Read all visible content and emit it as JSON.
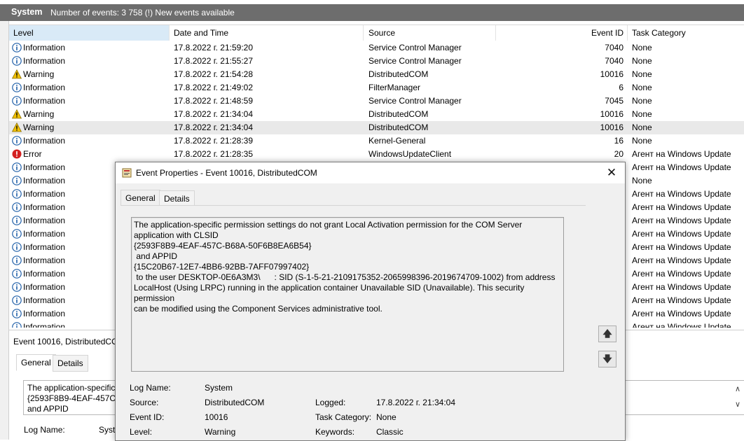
{
  "header": {
    "title": "System",
    "count_text": "Number of events: 3 758 (!) New events available"
  },
  "columns": {
    "level": "Level",
    "date": "Date and Time",
    "source": "Source",
    "event_id": "Event ID",
    "task": "Task Category"
  },
  "events": [
    {
      "level": "Information",
      "date": "17.8.2022 г. 21:59:20",
      "source": "Service Control Manager",
      "id": "7040",
      "task": "None"
    },
    {
      "level": "Information",
      "date": "17.8.2022 г. 21:55:27",
      "source": "Service Control Manager",
      "id": "7040",
      "task": "None"
    },
    {
      "level": "Warning",
      "date": "17.8.2022 г. 21:54:28",
      "source": "DistributedCOM",
      "id": "10016",
      "task": "None"
    },
    {
      "level": "Information",
      "date": "17.8.2022 г. 21:49:02",
      "source": "FilterManager",
      "id": "6",
      "task": "None"
    },
    {
      "level": "Information",
      "date": "17.8.2022 г. 21:48:59",
      "source": "Service Control Manager",
      "id": "7045",
      "task": "None"
    },
    {
      "level": "Warning",
      "date": "17.8.2022 г. 21:34:04",
      "source": "DistributedCOM",
      "id": "10016",
      "task": "None"
    },
    {
      "level": "Warning",
      "date": "17.8.2022 г. 21:34:04",
      "source": "DistributedCOM",
      "id": "10016",
      "task": "None"
    },
    {
      "level": "Information",
      "date": "17.8.2022 г. 21:28:39",
      "source": "Kernel-General",
      "id": "16",
      "task": "None"
    },
    {
      "level": "Error",
      "date": "17.8.2022 г. 21:28:35",
      "source": "WindowsUpdateClient",
      "id": "20",
      "task": "Агент на Windows Update"
    },
    {
      "level": "Information",
      "date": "",
      "source": "",
      "id": "",
      "task": "Агент на Windows Update"
    },
    {
      "level": "Information",
      "date": "",
      "source": "",
      "id": "",
      "task": "None"
    },
    {
      "level": "Information",
      "date": "",
      "source": "",
      "id": "",
      "task": "Агент на Windows Update"
    },
    {
      "level": "Information",
      "date": "",
      "source": "",
      "id": "",
      "task": "Агент на Windows Update"
    },
    {
      "level": "Information",
      "date": "",
      "source": "",
      "id": "",
      "task": "Агент на Windows Update"
    },
    {
      "level": "Information",
      "date": "",
      "source": "",
      "id": "",
      "task": "Агент на Windows Update"
    },
    {
      "level": "Information",
      "date": "",
      "source": "",
      "id": "",
      "task": "Агент на Windows Update"
    },
    {
      "level": "Information",
      "date": "",
      "source": "",
      "id": "",
      "task": "Агент на Windows Update"
    },
    {
      "level": "Information",
      "date": "",
      "source": "",
      "id": "",
      "task": "Агент на Windows Update"
    },
    {
      "level": "Information",
      "date": "",
      "source": "",
      "id": "",
      "task": "Агент на Windows Update"
    },
    {
      "level": "Information",
      "date": "",
      "source": "",
      "id": "",
      "task": "Агент на Windows Update"
    },
    {
      "level": "Information",
      "date": "",
      "source": "",
      "id": "",
      "task": "Агент на Windows Update"
    },
    {
      "level": "Information",
      "date": "",
      "source": "",
      "id": "",
      "task": "Агент на Windows Update"
    }
  ],
  "highlighted_row": 6,
  "lower_pane": {
    "title": "Event 10016, DistributedCOM",
    "tab_general": "General",
    "tab_details": "Details",
    "preview_line1": "The application-specific",
    "preview_line2": "{2593F8B9-4EAF-457C-B",
    "preview_line3": " and APPID",
    "log_name_label": "Log Name:",
    "log_name_value": "Syste"
  },
  "dialog": {
    "title": "Event Properties - Event 10016, DistributedCOM",
    "tab_general": "General",
    "tab_details": "Details",
    "description": "The application-specific permission settings do not grant Local Activation permission for the COM Server\napplication with CLSID\n{2593F8B9-4EAF-457C-B68A-50F6B8EA6B54}\n and APPID\n{15C20B67-12E7-4BB6-92BB-7AFF07997402}\n to the user DESKTOP-0E6A3M3\\      : SID (S-1-5-21-2109175352-2065998396-2019674709-1002) from address\nLocalHost (Using LRPC) running in the application container Unavailable SID (Unavailable). This security permission\ncan be modified using the Component Services administrative tool.",
    "up_icon": "arrow-up-icon",
    "down_icon": "arrow-down-icon",
    "fields": {
      "log_name_label": "Log Name:",
      "log_name_value": "System",
      "source_label": "Source:",
      "source_value": "DistributedCOM",
      "logged_label": "Logged:",
      "logged_value": "17.8.2022 г. 21:34:04",
      "event_id_label": "Event ID:",
      "event_id_value": "10016",
      "task_label": "Task Category:",
      "task_value": "None",
      "level_label": "Level:",
      "level_value": "Warning",
      "keywords_label": "Keywords:",
      "keywords_value": "Classic"
    }
  },
  "colors": {
    "header_bg": "#6d6d6d",
    "selected_col": "#d9eaf7",
    "info_blue": "#1f5fa8",
    "warning_yellow": "#f2c200",
    "error_red": "#d32020"
  }
}
